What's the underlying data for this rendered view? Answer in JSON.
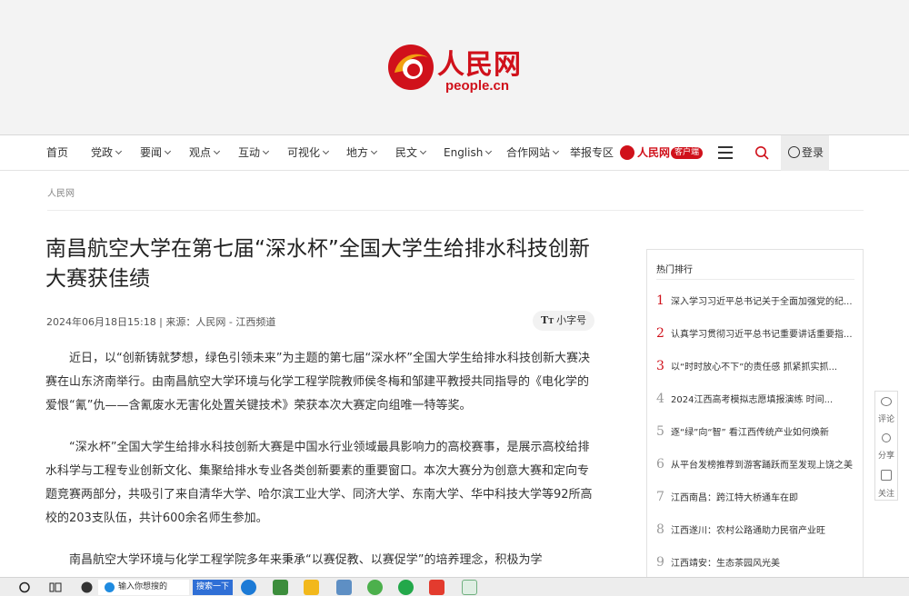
{
  "header": {
    "logo_cn": "人民网",
    "logo_en": "people.cn",
    "brand_red": "#d0111b"
  },
  "nav": {
    "items": [
      {
        "label": "首页",
        "dropdown": false
      },
      {
        "label": "党政",
        "dropdown": true
      },
      {
        "label": "要闻",
        "dropdown": true
      },
      {
        "label": "观点",
        "dropdown": true
      },
      {
        "label": "互动",
        "dropdown": true
      },
      {
        "label": "可视化",
        "dropdown": true
      },
      {
        "label": "地方",
        "dropdown": true
      },
      {
        "label": "民文",
        "dropdown": true
      },
      {
        "label": "English",
        "dropdown": true
      },
      {
        "label": "合作网站",
        "dropdown": true
      },
      {
        "label": "举报专区",
        "dropdown": false
      }
    ],
    "plus_label": "人民网+",
    "client_label": "客户端",
    "login_label": "登录",
    "menu_icon": "hamburger-menu-icon",
    "search_icon": "search-icon"
  },
  "breadcrumb": "人民网",
  "article": {
    "title": "南昌航空大学在第七届“深水杯”全国大学生给排水科技创新大赛获佳绩",
    "meta": "2024年06月18日15:18 | 来源：人民网 - 江西频道",
    "font_toggle": "小字号",
    "paragraphs": [
      "近日，以“创新铸就梦想，绿色引领未来”为主题的第七届“深水杯”全国大学生给排水科技创新大赛决赛在山东济南举行。由南昌航空大学环境与化学工程学院教师侯冬梅和邹建平教授共同指导的《电化学的爱恨“氰”仇——含氰废水无害化处置关键技术》荣获本次大赛定向组唯一特等奖。",
      "“深水杯”全国大学生给排水科技创新大赛是中国水行业领域最具影响力的高校赛事，是展示高校给排水科学与工程专业创新文化、集聚给排水专业各类创新要素的重要窗口。本次大赛分为创意大赛和定向专题竞赛两部分，共吸引了来自清华大学、哈尔滨工业大学、同济大学、东南大学、华中科技大学等92所高校的203支队伍，共计600余名师生参加。",
      "南昌航空大学环境与化学工程学院多年来秉承“以赛促教、以赛促学”的培养理念，积极为学"
    ]
  },
  "hot": {
    "title": "热门排行",
    "items": [
      {
        "rank": "1",
        "text": "深入学习习近平总书记关于全面加强党的纪..."
      },
      {
        "rank": "2",
        "text": "认真学习贯彻习近平总书记重要讲话重要指..."
      },
      {
        "rank": "3",
        "text": "以“时时放心不下”的责任感 抓紧抓实抓..."
      },
      {
        "rank": "4",
        "text": "2024江西高考模拟志愿填报演练 时间..."
      },
      {
        "rank": "5",
        "text": "逐“绿”向“智” 看江西传统产业如何焕新"
      },
      {
        "rank": "6",
        "text": "从平台发榜推荐到游客踊跃而至发现上饶之美"
      },
      {
        "rank": "7",
        "text": "江西南昌：跨江特大桥通车在即"
      },
      {
        "rank": "8",
        "text": "江西遂川：农村公路通助力民宿产业旺"
      },
      {
        "rank": "9",
        "text": "江西靖安：生态茶园风光美"
      }
    ]
  },
  "side_tools": [
    {
      "label": "评论",
      "icon": "comment-icon"
    },
    {
      "label": "分享",
      "icon": "share-icon"
    },
    {
      "label": "关注",
      "icon": "follow-icon"
    }
  ],
  "taskbar": {
    "search_placeholder": "输入你想搜的",
    "search_button": "搜索一下"
  }
}
